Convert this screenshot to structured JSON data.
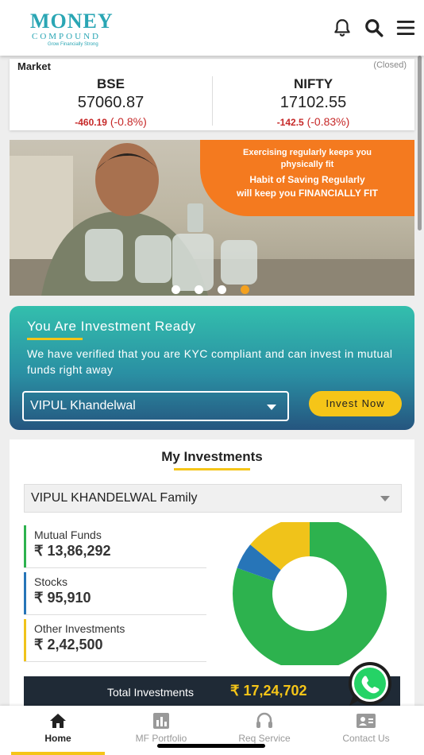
{
  "header": {
    "logo_main": "MONEY",
    "logo_sub": "COMPOUND",
    "logo_tagline": "Grow Financially Strong",
    "icons": [
      "bell-icon",
      "search-icon",
      "menu-icon"
    ]
  },
  "market": {
    "label": "Market",
    "status": "(Closed)",
    "indices": [
      {
        "name": "BSE",
        "value": "57060.87",
        "change": "-460.19",
        "pct": "(-0.8%)"
      },
      {
        "name": "NIFTY",
        "value": "17102.55",
        "change": "-142.5",
        "pct": "(-0.83%)"
      }
    ]
  },
  "banner": {
    "line1": "Exercising regularly keeps you",
    "line2": "physically fit",
    "line3": "Habit of Saving Regularly",
    "line4": "will keep you FINANCIALLY FIT",
    "slides": 4,
    "active_slide": 4
  },
  "ready": {
    "title": "You Are Investment Ready",
    "text": "We have verified that you are KYC compliant and can invest in mutual funds right away",
    "selected_user": "VIPUL Khandelwal",
    "invest_button": "Invest Now"
  },
  "investments": {
    "title": "My Investments",
    "family_select": "VIPUL KHANDELWAL Family",
    "categories": [
      {
        "label": "Mutual Funds",
        "value": "₹ 13,86,292",
        "amount": 1386292,
        "color": "#2db24e"
      },
      {
        "label": "Stocks",
        "value": "₹ 95,910",
        "amount": 95910,
        "color": "#2775b8"
      },
      {
        "label": "Other Investments",
        "value": "₹ 2,42,500",
        "amount": 242500,
        "color": "#f0c31a"
      }
    ],
    "total_label": "Total Investments",
    "total_value": "₹ 17,24,702"
  },
  "nav": {
    "items": [
      {
        "label": "Home",
        "icon": "home-icon"
      },
      {
        "label": "MF Portfolio",
        "icon": "bar-chart-icon"
      },
      {
        "label": "Req Service",
        "icon": "headset-icon"
      },
      {
        "label": "Contact Us",
        "icon": "contact-card-icon"
      }
    ],
    "active": 0
  },
  "colors": {
    "accent": "#f5c518",
    "negative": "#c62828",
    "banner_orange": "#f47a1f",
    "dark": "#1f2a36"
  }
}
